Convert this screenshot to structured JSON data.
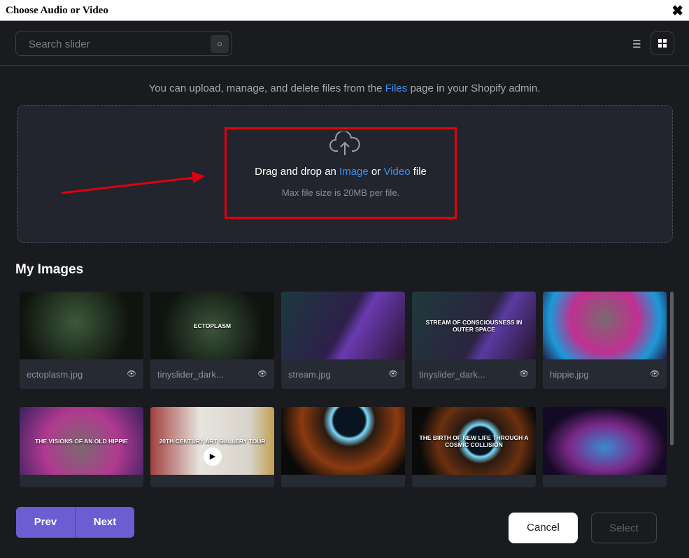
{
  "window": {
    "title": "Choose Audio or Video",
    "close_icon": "close-icon"
  },
  "search": {
    "placeholder": "Search slider"
  },
  "info": {
    "prefix": "You can upload, manage, and delete files from the ",
    "link": "Files",
    "suffix": " page in your Shopify admin."
  },
  "dropzone": {
    "text_prefix": "Drag and drop an ",
    "image_link": "Image",
    "or": " or ",
    "video_link": "Video",
    "text_suffix": " file",
    "max": "Max file size is 20MB per file."
  },
  "section_title": "My Images",
  "images": [
    {
      "name": "ectoplasm.jpg",
      "caption": "",
      "bg": "radial-gradient(circle at 45% 45%,#3c5a3a,#10140f 70%)"
    },
    {
      "name": "tinyslider_dark...",
      "caption": "ECTOPLASM",
      "bg": "radial-gradient(circle at 50% 55%,#3b5538,#0f1410 70%)"
    },
    {
      "name": "stream.jpg",
      "caption": "",
      "bg": "linear-gradient(120deg,#1b3a3e,#2e1f4a 50%,#6a3ab0 60%,#2a1530)"
    },
    {
      "name": "tinyslider_dark...",
      "caption": "STREAM OF CONSCIOUSNESS IN OUTER SPACE",
      "bg": "linear-gradient(120deg,#1e3a3b,#2b2440 55%,#5a3aa0 65%,#241428)"
    },
    {
      "name": "hippie.jpg",
      "caption": "",
      "bg": "radial-gradient(circle at 50% 40%,#7a6a70,#c03090 45%,#1a9ad8 75%,#2a1540)"
    },
    {
      "name": "",
      "caption": "THE VISIONS OF AN OLD HIPPIE",
      "bg": "radial-gradient(circle at 50% 60%,#7a6a70,#b03a90 50%,#3a2060)"
    },
    {
      "name": "",
      "caption": "20TH CENTURY ART GALLERY TOUR",
      "bg": "linear-gradient(90deg,#a04040,#e8e4de 40%,#d8d4cc 80%,#c0a050)"
    },
    {
      "name": "",
      "caption": "",
      "bg": "radial-gradient(circle at 55% 20%,#0a1420 18%,#7adcff 21%,#2a1a10 30%,#8a3a10 55%,#0a0a0a 80%)"
    },
    {
      "name": "",
      "caption": "THE BIRTH OF NEW LIFE THROUGH A COSMIC COLLISION",
      "bg": "radial-gradient(circle at 55% 50%,#0a1420 18%,#7adcff 21%,#2a1a10 30%,#6a3010 55%,#0a0a0a 80%)"
    },
    {
      "name": "",
      "caption": "",
      "bg": "radial-gradient(ellipse at 50% 60%,#3a8ad0,#7a2a8a 40%,#150a25 70%)"
    }
  ],
  "buttons": {
    "prev": "Prev",
    "next": "Next",
    "cancel": "Cancel",
    "select": "Select"
  },
  "annotation": {
    "color": "#e0000f"
  }
}
